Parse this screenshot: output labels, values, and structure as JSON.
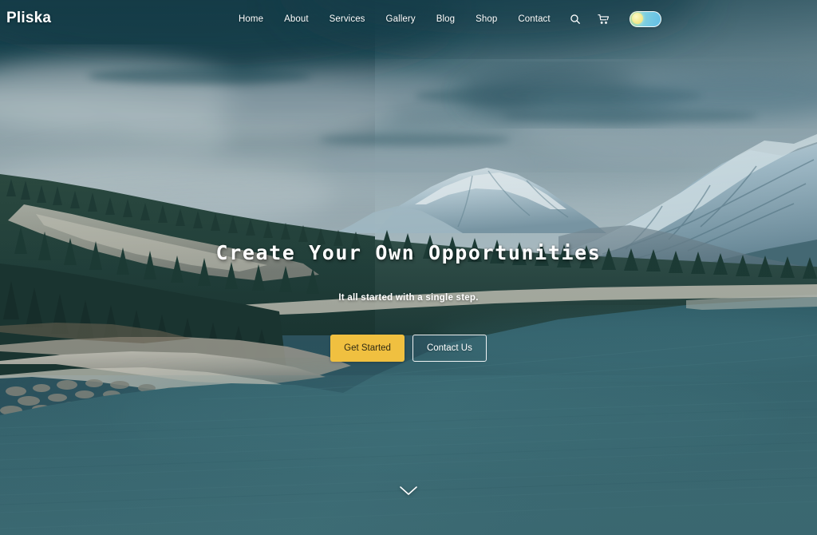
{
  "site": {
    "brand": "Pliska"
  },
  "nav": {
    "items": [
      {
        "label": "Home"
      },
      {
        "label": "About"
      },
      {
        "label": "Services"
      },
      {
        "label": "Gallery"
      },
      {
        "label": "Blog"
      },
      {
        "label": "Shop"
      },
      {
        "label": "Contact"
      }
    ],
    "icons": [
      {
        "name": "search-icon"
      },
      {
        "name": "cart-icon"
      }
    ],
    "theme_toggle": {
      "name": "theme-toggle-switch",
      "state": "light",
      "track_color": "#7fd0e0",
      "knob_color": "#f5eb92"
    }
  },
  "hero": {
    "title": "Create Your Own Opportunities",
    "subtitle": "It all started with a single step.",
    "primary_button": "Get Started",
    "secondary_button": "Contact Us",
    "scroll_icon": "chevron-down-icon",
    "background": "mountain-river-landscape"
  },
  "colors": {
    "accent": "#f0c040",
    "text_on_hero": "#ffffff",
    "sky_dark": "#1d4a55",
    "water": "#3a6670",
    "forest": "#24403a"
  }
}
